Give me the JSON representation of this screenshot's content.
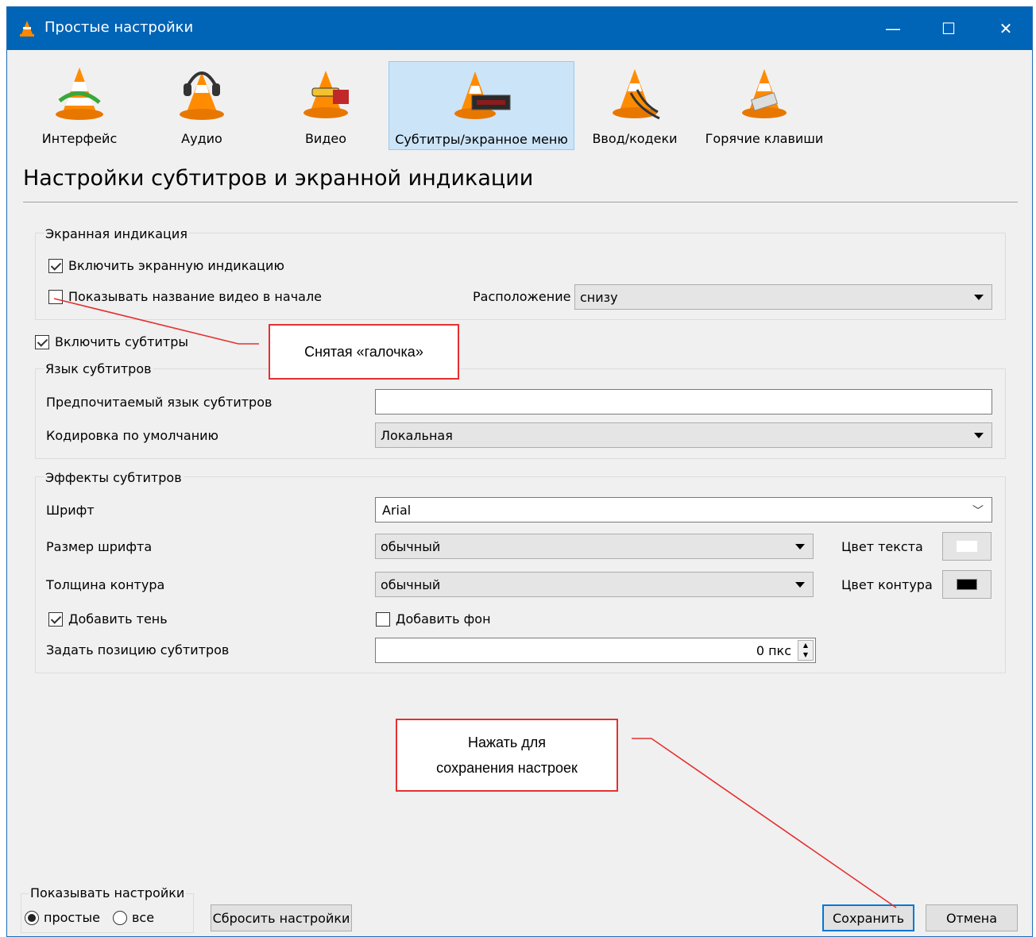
{
  "window": {
    "title": "Простые настройки",
    "minimize": "—",
    "maximize": "☐",
    "close": "✕"
  },
  "categories": [
    {
      "label": "Интерфейс",
      "icon": "interface-cone-icon"
    },
    {
      "label": "Аудио",
      "icon": "audio-cone-icon"
    },
    {
      "label": "Видео",
      "icon": "video-cone-icon"
    },
    {
      "label": "Субтитры/экранное меню",
      "icon": "subtitles-cone-icon",
      "selected": true
    },
    {
      "label": "Ввод/кодеки",
      "icon": "input-cone-icon"
    },
    {
      "label": "Горячие клавиши",
      "icon": "hotkeys-cone-icon"
    }
  ],
  "heading": "Настройки субтитров и экранной индикации",
  "osd": {
    "group_title": "Экранная индикация",
    "enable_osd": "Включить экранную индикацию",
    "show_title": "Показывать название видео в начале",
    "position_label": "Расположение",
    "position_value": "снизу"
  },
  "enable_subtitles": "Включить субтитры",
  "lang": {
    "group_title": "Язык субтитров",
    "preferred_label": "Предпочитаемый язык субтитров",
    "preferred_value": "",
    "encoding_label": "Кодировка по умолчанию",
    "encoding_value": "Локальная"
  },
  "effects": {
    "group_title": "Эффекты субтитров",
    "font_label": "Шрифт",
    "font_value": "Arial",
    "size_label": "Размер шрифта",
    "size_value": "обычный",
    "text_color_label": "Цвет текста",
    "outline_label": "Толщина контура",
    "outline_value": "обычный",
    "outline_color_label": "Цвет контура",
    "shadow_label": "Добавить тень",
    "background_label": "Добавить фон",
    "position_label": "Задать позицию субтитров",
    "position_value": "0 пкс"
  },
  "colors": {
    "text_color": "#ffffff",
    "outline_color": "#000000",
    "titlebar": "#0064b7",
    "callout_border": "#e53030"
  },
  "callouts": {
    "unchecked": "Снятая «галочка»",
    "save_line1": "Нажать для",
    "save_line2": "сохранения настроек"
  },
  "footer": {
    "group_title": "Показывать настройки",
    "simple": "простые",
    "all": "все",
    "reset": "Сбросить настройки",
    "save": "Сохранить",
    "cancel": "Отмена"
  }
}
